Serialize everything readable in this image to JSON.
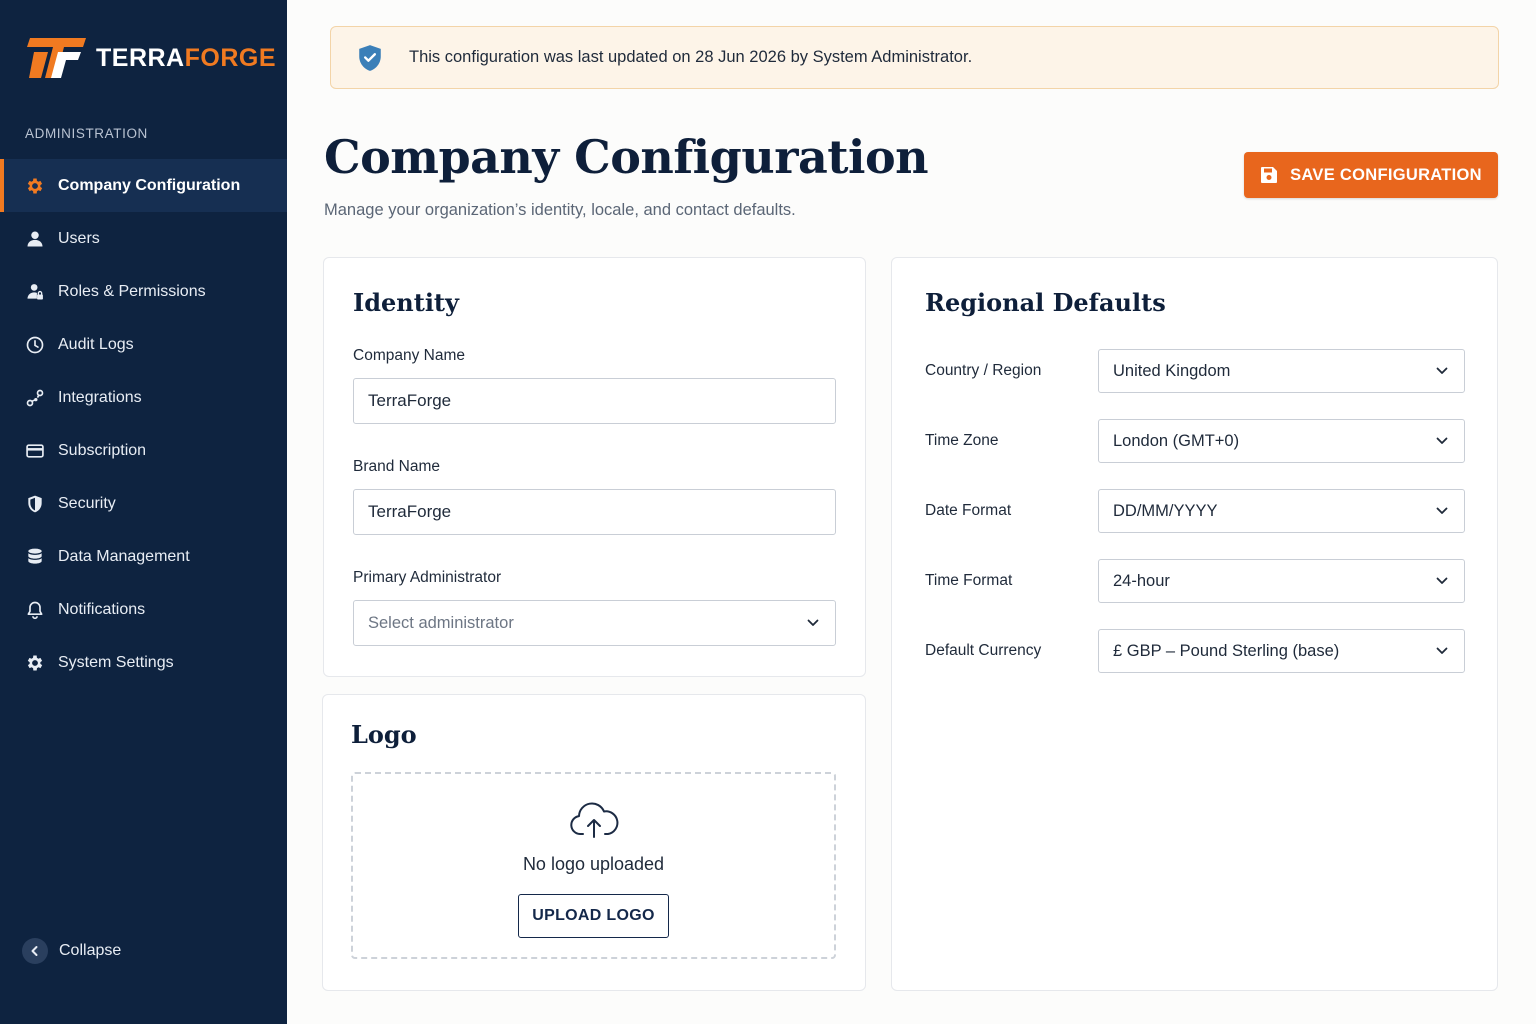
{
  "brand": {
    "name_part1": "TERRA",
    "name_part2": "FORGE",
    "accent": "#f07a21",
    "sidebar_bg": "#0e2340"
  },
  "sidebar": {
    "section_label": "ADMINISTRATION",
    "items": [
      {
        "label": "Company Configuration",
        "icon": "gear-icon",
        "active": true
      },
      {
        "label": "Users",
        "icon": "user-icon"
      },
      {
        "label": "Roles & Permissions",
        "icon": "user-lock-icon"
      },
      {
        "label": "Audit Logs",
        "icon": "clock-icon"
      },
      {
        "label": "Integrations",
        "icon": "link-icon"
      },
      {
        "label": "Subscription",
        "icon": "credit-card-icon"
      },
      {
        "label": "Security",
        "icon": "shield-icon"
      },
      {
        "label": "Data Management",
        "icon": "database-icon"
      },
      {
        "label": "Notifications",
        "icon": "bell-icon"
      },
      {
        "label": "System Settings",
        "icon": "gear-icon"
      }
    ],
    "collapse_label": "Collapse"
  },
  "banner": {
    "text": "This configuration was last updated on 28 Jun 2026 by System Administrator.",
    "icon": "shield-check-icon"
  },
  "header": {
    "title": "Company Configuration",
    "subtitle": "Manage your organization’s identity, locale, and contact defaults.",
    "save_label": "SAVE CONFIGURATION",
    "save_icon": "floppy-disk-icon"
  },
  "identity": {
    "title": "Identity",
    "company_name_label": "Company Name",
    "company_name_value": "TerraForge",
    "brand_name_label": "Brand Name",
    "brand_name_value": "TerraForge",
    "admin_label": "Primary Administrator",
    "admin_placeholder": "Select administrator"
  },
  "logo": {
    "title": "Logo",
    "empty_text": "No logo uploaded",
    "upload_label": "UPLOAD LOGO",
    "icon": "cloud-upload-icon"
  },
  "regional": {
    "title": "Regional Defaults",
    "fields": [
      {
        "label": "Country / Region",
        "value": "United Kingdom"
      },
      {
        "label": "Time Zone",
        "value": "London (GMT+0)"
      },
      {
        "label": "Date Format",
        "value": "DD/MM/YYYY"
      },
      {
        "label": "Time Format",
        "value": "24-hour"
      },
      {
        "label": "Default Currency",
        "value": "£ GBP – Pound Sterling (base)"
      }
    ]
  }
}
